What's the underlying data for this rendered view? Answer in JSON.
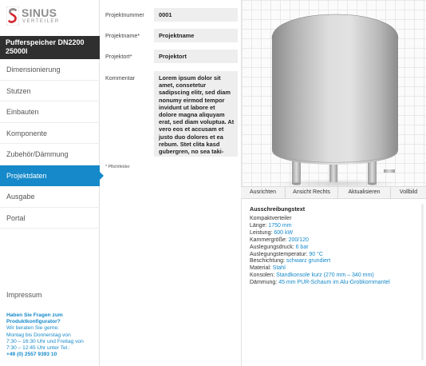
{
  "brand": {
    "name": "SINUS",
    "sub": "VERTEILER",
    "accent": "#1589c9",
    "logo_red": "#d6242b"
  },
  "product": {
    "line1": "Pufferspeicher DN2200",
    "line2": "25000l"
  },
  "nav": {
    "items": [
      {
        "label": "Dimensionierung",
        "active": false
      },
      {
        "label": "Stutzen",
        "active": false
      },
      {
        "label": "Einbauten",
        "active": false
      },
      {
        "label": "Komponente",
        "active": false
      },
      {
        "label": "Zubehör/Dämmung",
        "active": false
      },
      {
        "label": "Projektdaten",
        "active": true
      },
      {
        "label": "Ausgabe",
        "active": false
      },
      {
        "label": "Portal",
        "active": false
      }
    ],
    "impressum": "Impressum"
  },
  "help": {
    "question": "Haben Sie Fragen zum Produktkonfigurator?",
    "lines": [
      "Wir beraten Sie gerne:",
      "Montag bis Donnerstag von",
      "7:30 – 16:30 Uhr und Freitag von",
      "7:30 – 12:45 Uhr unter Tel.:"
    ],
    "phone": "+49 (0) 2557 9393 10"
  },
  "form": {
    "fields": [
      {
        "label": "Projektnummer",
        "value": "0001"
      },
      {
        "label": "Projektname*",
        "value": "Projektname"
      },
      {
        "label": "Projektort*",
        "value": "Projektort"
      }
    ],
    "comment_label": "Kommentar",
    "comment_value": "Lorem ipsum dolor sit amet, consetetur sadipscing elitr, sed diam nonumy eirmod tempor invidunt ut labore et dolore magna aliquyam erat, sed diam voluptua. At vero eos et accusam et justo duo dolores et ea rebum. Stet clita kasd gubergren, no sea taki-mata sanctus est Lorem ipsum dolor sit amet. Lorem",
    "required_note": "* Pflichtfelder"
  },
  "viewer": {
    "buttons": [
      "Ausrichten",
      "Ansicht Rechts",
      "Aktualisieren",
      "Vollbild"
    ]
  },
  "tender": {
    "title": "Ausschreibungstext",
    "lines": [
      {
        "label": "Kompaktverteiler",
        "value": ""
      },
      {
        "label": "Länge: ",
        "value": "1750 mm"
      },
      {
        "label": "Leistung: ",
        "value": "600 kW"
      },
      {
        "label": "Kammergröße: ",
        "value": "200/120"
      },
      {
        "label": "Auslegungsdruck: ",
        "value": "6 bar"
      },
      {
        "label": "Auslegungstemperatur: ",
        "value": "90 °C"
      },
      {
        "label": "Beschichtung: ",
        "value": "schwarz grundiert"
      },
      {
        "label": "Material: ",
        "value": "Stahl"
      },
      {
        "label": "Konsolen: ",
        "value": "Standkonsole kurz (270 mm – 340 mm)"
      },
      {
        "label": "Dämmung: ",
        "value": "45 mm PUR-Schaum im Alu-Grobkornmantel"
      }
    ]
  }
}
